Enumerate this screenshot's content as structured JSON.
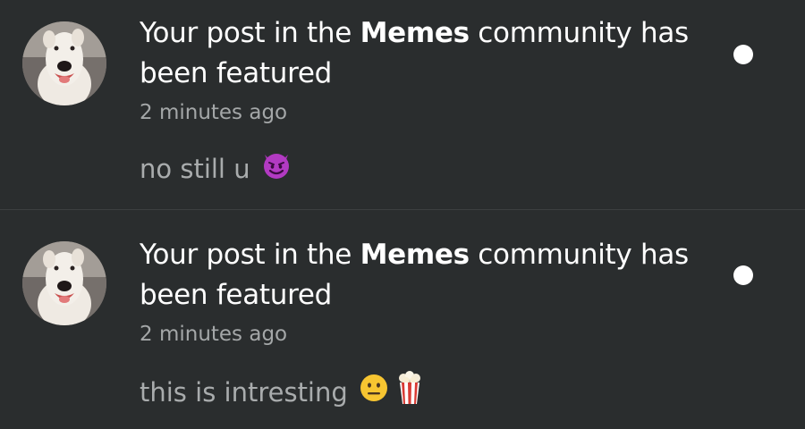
{
  "notifications": [
    {
      "title_prefix": "Your post in the ",
      "community": "Memes",
      "title_suffix_line1": " community has",
      "title_suffix_line2": "been featured",
      "time": "2 minutes ago",
      "message": "no still u",
      "emojis": [
        "smiling-face-with-horns-emoji"
      ],
      "unread": true
    },
    {
      "title_prefix": "Your post in the ",
      "community": "Memes",
      "title_suffix_line1": " community has",
      "title_suffix_line2": "been featured",
      "time": "2 minutes ago",
      "message": "this is intresting",
      "emojis": [
        "neutral-face-emoji",
        "popcorn-emoji"
      ],
      "unread": true
    }
  ],
  "colors": {
    "background": "#2a2d2e",
    "divider": "#3c3f40",
    "title": "#ffffff",
    "secondary": "#a4a7a8",
    "unread_dot": "#ffffff"
  }
}
